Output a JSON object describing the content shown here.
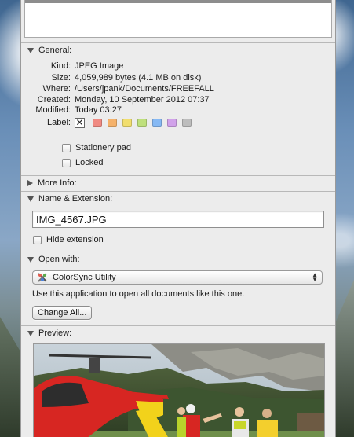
{
  "general": {
    "title": "General:",
    "rows": [
      {
        "key": "Kind:",
        "value": "JPEG Image"
      },
      {
        "key": "Size:",
        "value": "4,059,989 bytes (4.1 MB on disk)"
      },
      {
        "key": "Where:",
        "value": "/Users/jpank/Documents/FREEFALL"
      },
      {
        "key": "Created:",
        "value": "Monday, 10 September 2012 07:37"
      },
      {
        "key": "Modified:",
        "value": "Today 03:27"
      }
    ],
    "label_key": "Label:",
    "label_none_glyph": "✕",
    "label_colors": [
      "#f08a82",
      "#f5b26b",
      "#f1de6e",
      "#bfe07c",
      "#86b9f4",
      "#d1a2ea",
      "#bdbdbd"
    ],
    "stationery_pad": "Stationery pad",
    "locked": "Locked"
  },
  "more_info": {
    "title": "More Info:"
  },
  "name_extension": {
    "title": "Name & Extension:",
    "filename": "IMG_4567.JPG",
    "hide_extension": "Hide extension"
  },
  "open_with": {
    "title": "Open with:",
    "app": "ColorSync Utility",
    "app_icon": "colorsync-icon",
    "description": "Use this application to open all documents like this one.",
    "change_all": "Change All..."
  },
  "preview": {
    "title": "Preview:"
  }
}
